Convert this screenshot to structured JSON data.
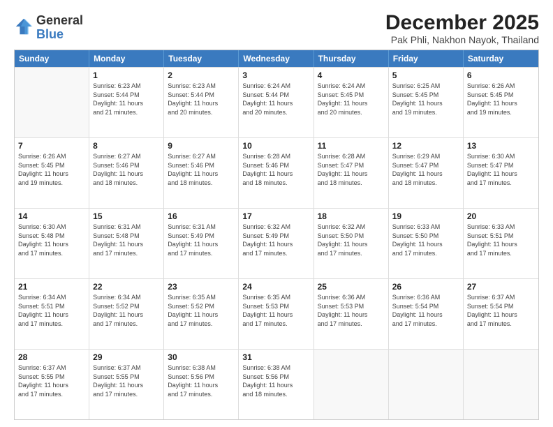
{
  "logo": {
    "general": "General",
    "blue": "Blue"
  },
  "title": "December 2025",
  "subtitle": "Pak Phli, Nakhon Nayok, Thailand",
  "days": [
    "Sunday",
    "Monday",
    "Tuesday",
    "Wednesday",
    "Thursday",
    "Friday",
    "Saturday"
  ],
  "weeks": [
    [
      {
        "day": "",
        "info": ""
      },
      {
        "day": "1",
        "info": "Sunrise: 6:23 AM\nSunset: 5:44 PM\nDaylight: 11 hours\nand 21 minutes."
      },
      {
        "day": "2",
        "info": "Sunrise: 6:23 AM\nSunset: 5:44 PM\nDaylight: 11 hours\nand 20 minutes."
      },
      {
        "day": "3",
        "info": "Sunrise: 6:24 AM\nSunset: 5:44 PM\nDaylight: 11 hours\nand 20 minutes."
      },
      {
        "day": "4",
        "info": "Sunrise: 6:24 AM\nSunset: 5:45 PM\nDaylight: 11 hours\nand 20 minutes."
      },
      {
        "day": "5",
        "info": "Sunrise: 6:25 AM\nSunset: 5:45 PM\nDaylight: 11 hours\nand 19 minutes."
      },
      {
        "day": "6",
        "info": "Sunrise: 6:26 AM\nSunset: 5:45 PM\nDaylight: 11 hours\nand 19 minutes."
      }
    ],
    [
      {
        "day": "7",
        "info": "Sunrise: 6:26 AM\nSunset: 5:45 PM\nDaylight: 11 hours\nand 19 minutes."
      },
      {
        "day": "8",
        "info": "Sunrise: 6:27 AM\nSunset: 5:46 PM\nDaylight: 11 hours\nand 18 minutes."
      },
      {
        "day": "9",
        "info": "Sunrise: 6:27 AM\nSunset: 5:46 PM\nDaylight: 11 hours\nand 18 minutes."
      },
      {
        "day": "10",
        "info": "Sunrise: 6:28 AM\nSunset: 5:46 PM\nDaylight: 11 hours\nand 18 minutes."
      },
      {
        "day": "11",
        "info": "Sunrise: 6:28 AM\nSunset: 5:47 PM\nDaylight: 11 hours\nand 18 minutes."
      },
      {
        "day": "12",
        "info": "Sunrise: 6:29 AM\nSunset: 5:47 PM\nDaylight: 11 hours\nand 18 minutes."
      },
      {
        "day": "13",
        "info": "Sunrise: 6:30 AM\nSunset: 5:47 PM\nDaylight: 11 hours\nand 17 minutes."
      }
    ],
    [
      {
        "day": "14",
        "info": "Sunrise: 6:30 AM\nSunset: 5:48 PM\nDaylight: 11 hours\nand 17 minutes."
      },
      {
        "day": "15",
        "info": "Sunrise: 6:31 AM\nSunset: 5:48 PM\nDaylight: 11 hours\nand 17 minutes."
      },
      {
        "day": "16",
        "info": "Sunrise: 6:31 AM\nSunset: 5:49 PM\nDaylight: 11 hours\nand 17 minutes."
      },
      {
        "day": "17",
        "info": "Sunrise: 6:32 AM\nSunset: 5:49 PM\nDaylight: 11 hours\nand 17 minutes."
      },
      {
        "day": "18",
        "info": "Sunrise: 6:32 AM\nSunset: 5:50 PM\nDaylight: 11 hours\nand 17 minutes."
      },
      {
        "day": "19",
        "info": "Sunrise: 6:33 AM\nSunset: 5:50 PM\nDaylight: 11 hours\nand 17 minutes."
      },
      {
        "day": "20",
        "info": "Sunrise: 6:33 AM\nSunset: 5:51 PM\nDaylight: 11 hours\nand 17 minutes."
      }
    ],
    [
      {
        "day": "21",
        "info": "Sunrise: 6:34 AM\nSunset: 5:51 PM\nDaylight: 11 hours\nand 17 minutes."
      },
      {
        "day": "22",
        "info": "Sunrise: 6:34 AM\nSunset: 5:52 PM\nDaylight: 11 hours\nand 17 minutes."
      },
      {
        "day": "23",
        "info": "Sunrise: 6:35 AM\nSunset: 5:52 PM\nDaylight: 11 hours\nand 17 minutes."
      },
      {
        "day": "24",
        "info": "Sunrise: 6:35 AM\nSunset: 5:53 PM\nDaylight: 11 hours\nand 17 minutes."
      },
      {
        "day": "25",
        "info": "Sunrise: 6:36 AM\nSunset: 5:53 PM\nDaylight: 11 hours\nand 17 minutes."
      },
      {
        "day": "26",
        "info": "Sunrise: 6:36 AM\nSunset: 5:54 PM\nDaylight: 11 hours\nand 17 minutes."
      },
      {
        "day": "27",
        "info": "Sunrise: 6:37 AM\nSunset: 5:54 PM\nDaylight: 11 hours\nand 17 minutes."
      }
    ],
    [
      {
        "day": "28",
        "info": "Sunrise: 6:37 AM\nSunset: 5:55 PM\nDaylight: 11 hours\nand 17 minutes."
      },
      {
        "day": "29",
        "info": "Sunrise: 6:37 AM\nSunset: 5:55 PM\nDaylight: 11 hours\nand 17 minutes."
      },
      {
        "day": "30",
        "info": "Sunrise: 6:38 AM\nSunset: 5:56 PM\nDaylight: 11 hours\nand 17 minutes."
      },
      {
        "day": "31",
        "info": "Sunrise: 6:38 AM\nSunset: 5:56 PM\nDaylight: 11 hours\nand 18 minutes."
      },
      {
        "day": "",
        "info": ""
      },
      {
        "day": "",
        "info": ""
      },
      {
        "day": "",
        "info": ""
      }
    ]
  ]
}
